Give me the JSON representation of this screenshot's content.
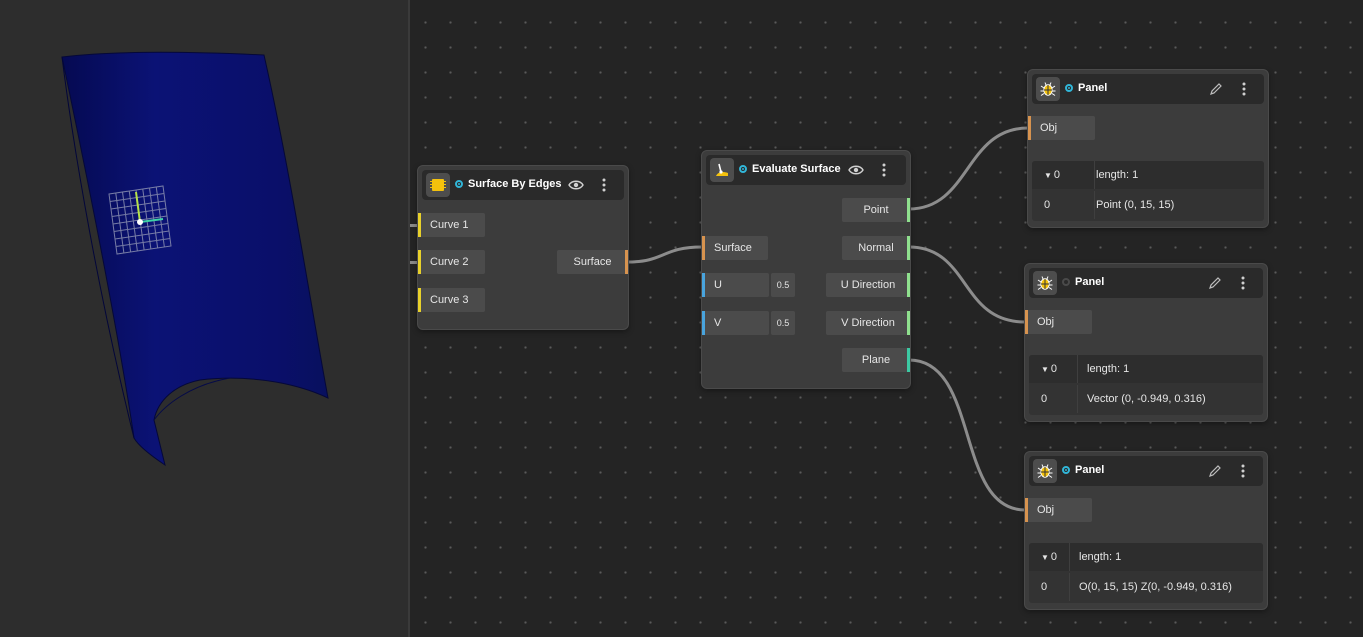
{
  "nodes": {
    "surface_by_edges": {
      "title": "Surface By Edges",
      "inputs": [
        "Curve 1",
        "Curve 2",
        "Curve 3"
      ],
      "output": "Surface"
    },
    "evaluate_surface": {
      "title": "Evaluate Surface",
      "inputs": {
        "surface": "Surface",
        "u": {
          "label": "U",
          "value": "0.5"
        },
        "v": {
          "label": "V",
          "value": "0.5"
        }
      },
      "outputs": [
        "Point",
        "Normal",
        "U Direction",
        "V Direction",
        "Plane"
      ]
    },
    "panels": [
      {
        "title": "Panel",
        "input": "Obj",
        "index_label": "0",
        "length": "length: 1",
        "row_index": "0",
        "row_value": "Point (0, 15, 15)",
        "active": true
      },
      {
        "title": "Panel",
        "input": "Obj",
        "index_label": "0",
        "length": "length: 1",
        "row_index": "0",
        "row_value": "Vector (0, -0.949, 0.316)",
        "active": false
      },
      {
        "title": "Panel",
        "input": "Obj",
        "index_label": "0",
        "length": "length: 1",
        "row_index": "0",
        "row_value": "O(0, 15, 15) Z(0, -0.949, 0.316)",
        "active": true
      }
    ]
  },
  "icons": {
    "preview": "eye-icon",
    "menu": "more-vertical-icon",
    "edit": "pencil-icon",
    "debug": "bug-icon",
    "surface_by_edges": "surface-chip-icon",
    "evaluate_surface": "evaluate-surface-icon"
  },
  "colors": {
    "curve_port": "#e8d12b",
    "surface_port": "#d7934f",
    "number_port": "#49a4dd",
    "vector_port": "#8fe08e",
    "plane_port": "#3cc9a3",
    "status_active": "#31b6d8",
    "surface_mesh": "#0a0f6e"
  }
}
